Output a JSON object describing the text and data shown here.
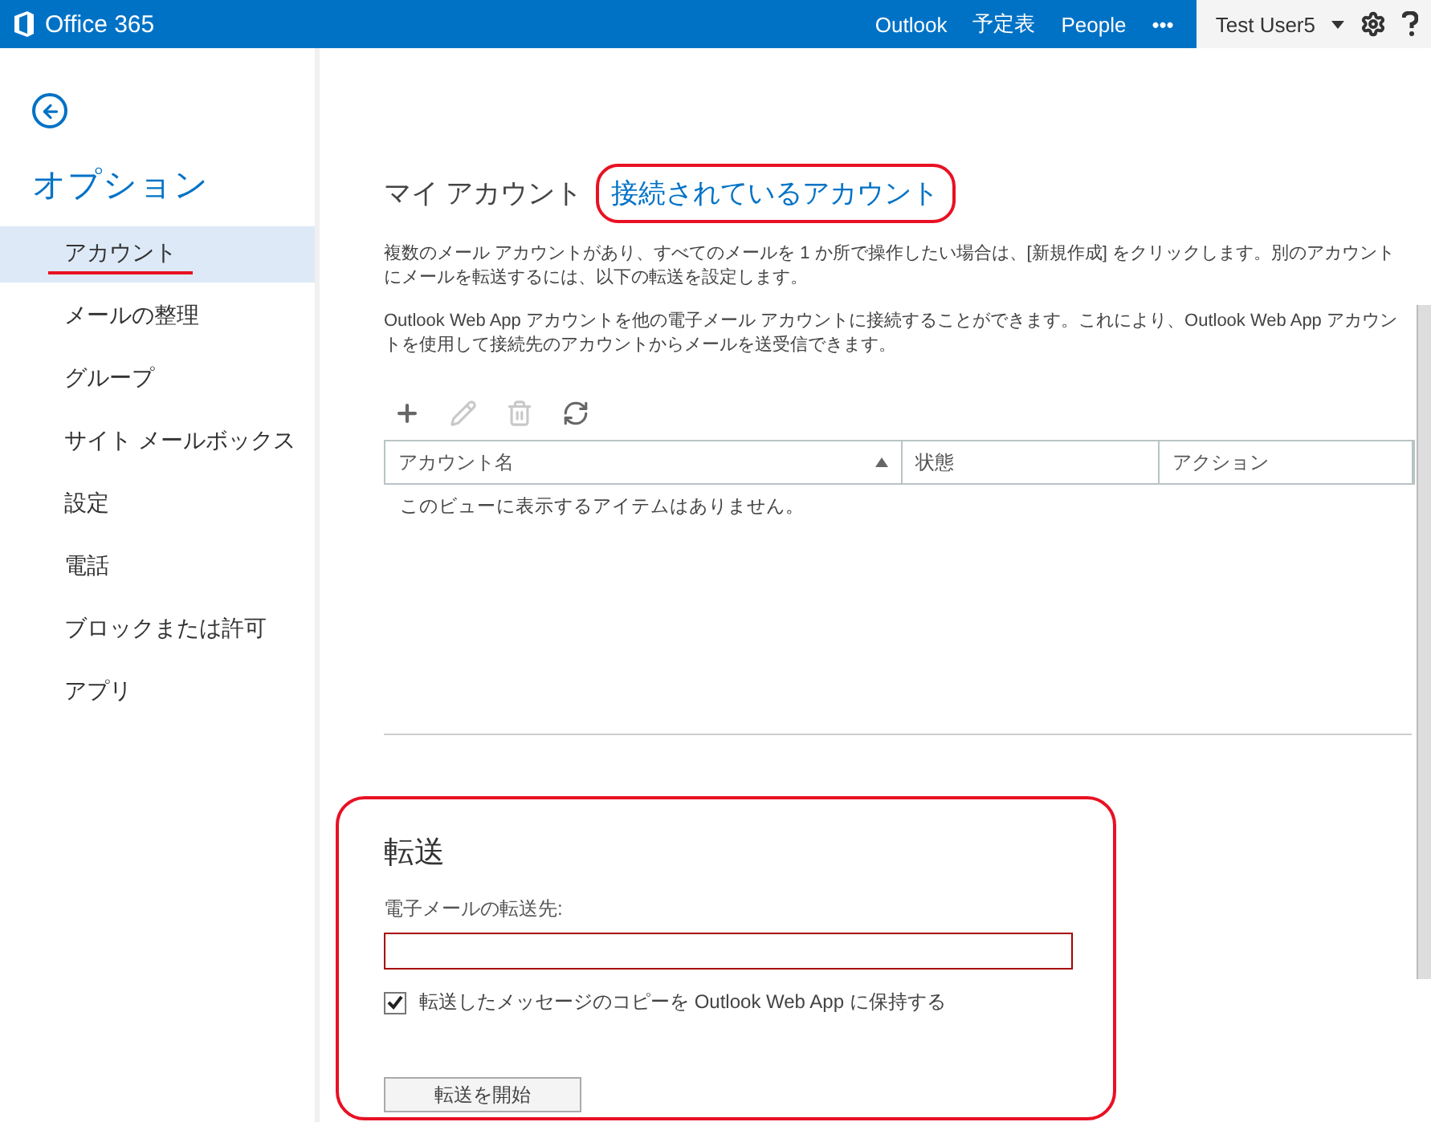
{
  "topbar": {
    "brand": "Office 365",
    "nav": [
      {
        "label": "Outlook"
      },
      {
        "label": "予定表"
      },
      {
        "label": "People"
      }
    ],
    "more": "•••",
    "user": "Test User5"
  },
  "sidebar": {
    "title": "オプション",
    "items": [
      {
        "label": "アカウント",
        "selected": true
      },
      {
        "label": "メールの整理",
        "selected": false
      },
      {
        "label": "グループ",
        "selected": false
      },
      {
        "label": "サイト メールボックス",
        "selected": false
      },
      {
        "label": "設定",
        "selected": false
      },
      {
        "label": "電話",
        "selected": false
      },
      {
        "label": "ブロックまたは許可",
        "selected": false
      },
      {
        "label": "アプリ",
        "selected": false
      }
    ]
  },
  "tabs": [
    {
      "label": "マイ アカウント",
      "selected": false
    },
    {
      "label": "接続されているアカウント",
      "selected": true
    }
  ],
  "paragraphs": [
    "複数のメール アカウントがあり、すべてのメールを 1 か所で操作したい場合は、[新規作成] をクリックします。別のアカウントにメールを転送するには、以下の転送を設定します。",
    "Outlook Web App アカウントを他の電子メール アカウントに接続することができます。これにより、Outlook Web App アカウントを使用して接続先のアカウントからメールを送受信できます。"
  ],
  "toolbar": [
    {
      "kind": "add",
      "disabled": false
    },
    {
      "kind": "edit",
      "disabled": true
    },
    {
      "kind": "delete",
      "disabled": true
    },
    {
      "kind": "refresh",
      "disabled": false
    }
  ],
  "table": {
    "columns": [
      {
        "label": "アカウント名",
        "sorted": true
      },
      {
        "label": "状態",
        "sorted": false
      },
      {
        "label": "アクション",
        "sorted": false
      }
    ],
    "empty_message": "このビューに表示するアイテムはありません。"
  },
  "forwarding": {
    "title": "転送",
    "field_label": "電子メールの転送先:",
    "keep_copy": {
      "label": "転送したメッセージのコピーを Outlook Web App に保持する",
      "checked": true
    },
    "button": "転送を開始"
  }
}
